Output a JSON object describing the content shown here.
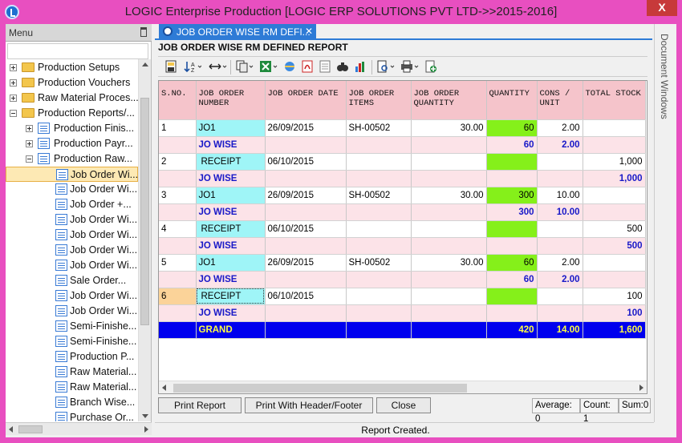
{
  "window": {
    "title": "LOGIC Enterprise Production  [LOGIC ERP SOLUTIONS PVT LTD->>2015-2016]",
    "close_label": "X"
  },
  "menu": {
    "header": "Menu",
    "items": [
      {
        "label": "Production Setups",
        "type": "folder",
        "level": 0,
        "expander": "plus"
      },
      {
        "label": "Production Vouchers",
        "type": "folder",
        "level": 0,
        "expander": "plus"
      },
      {
        "label": "Raw Material Proces...",
        "type": "folder",
        "level": 0,
        "expander": "plus"
      },
      {
        "label": "Production Reports/...",
        "type": "folder",
        "level": 0,
        "expander": "minus"
      },
      {
        "label": "Production Finis...",
        "type": "report",
        "level": 1,
        "expander": "plus"
      },
      {
        "label": "Production Payr...",
        "type": "report",
        "level": 1,
        "expander": "plus"
      },
      {
        "label": "Production Raw...",
        "type": "report",
        "level": 1,
        "expander": "minus"
      },
      {
        "label": "Job Order Wi...",
        "type": "report",
        "level": 2,
        "selected": true
      },
      {
        "label": "Job Order Wi...",
        "type": "report",
        "level": 2
      },
      {
        "label": "Job Order +...",
        "type": "report",
        "level": 2
      },
      {
        "label": "Job Order Wi...",
        "type": "report",
        "level": 2
      },
      {
        "label": "Job Order Wi...",
        "type": "report",
        "level": 2
      },
      {
        "label": "Job Order Wi...",
        "type": "report",
        "level": 2
      },
      {
        "label": "Job Order Wi...",
        "type": "report",
        "level": 2
      },
      {
        "label": "Sale Order...",
        "type": "report",
        "level": 2
      },
      {
        "label": "Job Order Wi...",
        "type": "report",
        "level": 2
      },
      {
        "label": "Job Order Wi...",
        "type": "report",
        "level": 2
      },
      {
        "label": "Semi-Finishe...",
        "type": "report",
        "level": 2
      },
      {
        "label": "Semi-Finishe...",
        "type": "report",
        "level": 2
      },
      {
        "label": "Production P...",
        "type": "report",
        "level": 2
      },
      {
        "label": "Raw Material...",
        "type": "report",
        "level": 2
      },
      {
        "label": "Raw Material...",
        "type": "report",
        "level": 2
      },
      {
        "label": "Branch Wise...",
        "type": "report",
        "level": 2
      },
      {
        "label": "Purchase Or...",
        "type": "report",
        "level": 2
      }
    ]
  },
  "tab": {
    "label": "JOB ORDER WISE RM DEFI...",
    "close": "✕"
  },
  "report": {
    "title": "JOB ORDER WISE RM DEFINED REPORT",
    "columns": [
      "S.NO.",
      "JOB ORDER NUMBER",
      "JOB ORDER DATE",
      "JOB ORDER ITEMS",
      "JOB ORDER QUANTITY",
      "QUANTITY",
      "CONS / UNIT",
      "TOTAL STOCK"
    ],
    "rows": [
      {
        "kind": "jo",
        "sno": "1",
        "number": "JO1",
        "date": "26/09/2015",
        "items": "SH-00502",
        "joqty": "30.00",
        "qty": "60",
        "cons": "2.00",
        "stock": ""
      },
      {
        "kind": "wise",
        "sno": "",
        "number": "JO WISE",
        "date": "",
        "items": "",
        "joqty": "",
        "qty": "60",
        "cons": "2.00",
        "stock": ""
      },
      {
        "kind": "receipt",
        "sno": "2",
        "number": "RECEIPT",
        "date": "06/10/2015",
        "items": "",
        "joqty": "",
        "qty": "",
        "cons": "",
        "stock": "1,000"
      },
      {
        "kind": "wise",
        "sno": "",
        "number": "JO WISE",
        "date": "",
        "items": "",
        "joqty": "",
        "qty": "",
        "cons": "",
        "stock": "1,000"
      },
      {
        "kind": "jo",
        "sno": "3",
        "number": "JO1",
        "date": "26/09/2015",
        "items": "SH-00502",
        "joqty": "30.00",
        "qty": "300",
        "cons": "10.00",
        "stock": ""
      },
      {
        "kind": "wise",
        "sno": "",
        "number": "JO WISE",
        "date": "",
        "items": "",
        "joqty": "",
        "qty": "300",
        "cons": "10.00",
        "stock": ""
      },
      {
        "kind": "receipt",
        "sno": "4",
        "number": "RECEIPT",
        "date": "06/10/2015",
        "items": "",
        "joqty": "",
        "qty": "",
        "cons": "",
        "stock": "500"
      },
      {
        "kind": "wise",
        "sno": "",
        "number": "JO WISE",
        "date": "",
        "items": "",
        "joqty": "",
        "qty": "",
        "cons": "",
        "stock": "500"
      },
      {
        "kind": "jo",
        "sno": "5",
        "number": "JO1",
        "date": "26/09/2015",
        "items": "SH-00502",
        "joqty": "30.00",
        "qty": "60",
        "cons": "2.00",
        "stock": ""
      },
      {
        "kind": "wise",
        "sno": "",
        "number": "JO WISE",
        "date": "",
        "items": "",
        "joqty": "",
        "qty": "60",
        "cons": "2.00",
        "stock": ""
      },
      {
        "kind": "receipt",
        "sno": "6",
        "number": "RECEIPT",
        "date": "06/10/2015",
        "items": "",
        "joqty": "",
        "qty": "",
        "cons": "",
        "stock": "100",
        "highlight": true
      },
      {
        "kind": "wise",
        "sno": "",
        "number": "JO WISE",
        "date": "",
        "items": "",
        "joqty": "",
        "qty": "",
        "cons": "",
        "stock": "100"
      },
      {
        "kind": "grand",
        "sno": "",
        "number": "GRAND",
        "date": "",
        "items": "",
        "joqty": "",
        "qty": "420",
        "cons": "14.00",
        "stock": "1,600"
      }
    ]
  },
  "buttons": {
    "print": "Print Report",
    "print_header": "Print With Header/Footer",
    "close": "Close"
  },
  "stats": {
    "average": "Average: 0",
    "count": "Count: 1",
    "sum": "Sum:0"
  },
  "status": "Report Created.",
  "docwin_label": "Document Windows",
  "colors": {
    "accent": "#2e7bd6",
    "frame": "#e84fc0",
    "header": "#f5c4cb",
    "qty": "#85f01a",
    "jo": "#9ff5f7",
    "grand": "#0000ee"
  }
}
